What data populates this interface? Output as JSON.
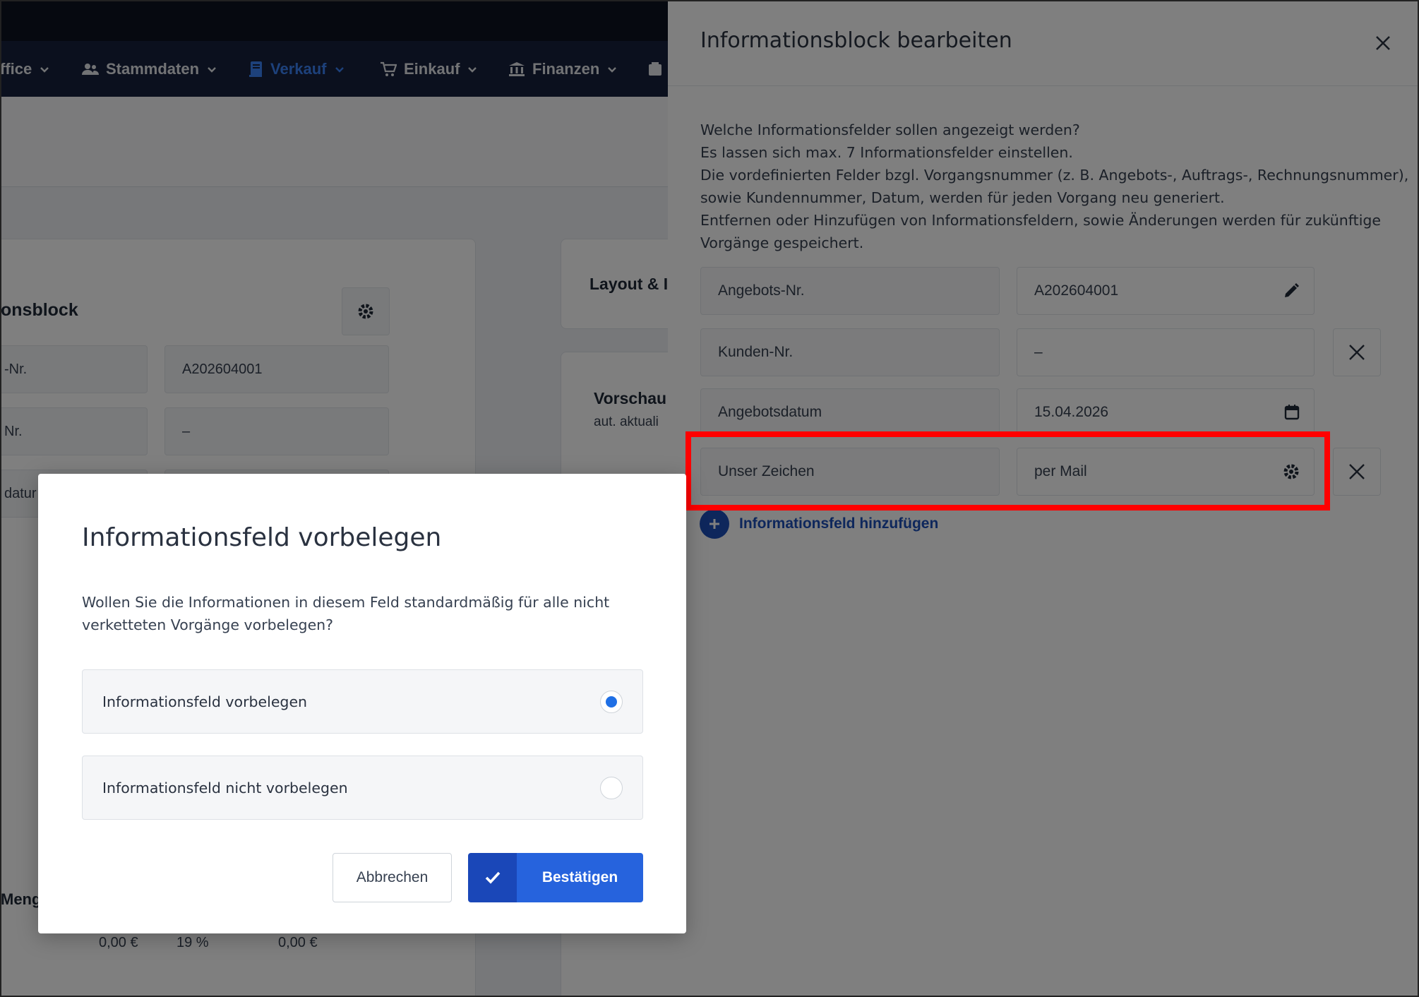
{
  "nav": {
    "items": [
      {
        "label": "ffice",
        "icon": "chevron-down-icon"
      },
      {
        "label": "Stammdaten",
        "icon": "users-icon"
      },
      {
        "label": "Verkauf",
        "icon": "document-icon",
        "active": true
      },
      {
        "label": "Einkauf",
        "icon": "cart-icon"
      },
      {
        "label": "Finanzen",
        "icon": "bank-icon"
      }
    ]
  },
  "background": {
    "block_title": "onsblock",
    "fields": [
      {
        "label": "-Nr.",
        "value": "A202604001"
      },
      {
        "label": "Nr.",
        "value": "–"
      },
      {
        "label": "datur",
        "value": ""
      }
    ],
    "layout_title": "Layout & I",
    "preview_title": "Vorschau",
    "preview_sub": "aut. aktuali",
    "table_header_fragment": "Menge",
    "table_values": [
      "0,00 €",
      "19 %",
      "0,00 €"
    ]
  },
  "panel": {
    "title": "Informationsblock bearbeiten",
    "description_lines": [
      "Welche Informationsfelder sollen angezeigt werden?",
      "Es lassen sich max. 7 Informationsfelder einstellen.",
      "Die vordefinierten Felder bzgl. Vorgangsnummer (z. B. Angebots-, Auftrags-, Rechnungsnummer),",
      "sowie Kundennummer, Datum, werden für jeden Vorgang neu generiert.",
      "Entfernen oder Hinzufügen von Informationsfeldern, sowie Änderungen werden für zukünftige",
      "Vorgänge gespeichert."
    ],
    "rows": [
      {
        "label": "Angebots-Nr.",
        "value": "A202604001",
        "value_icon": "pencil-icon",
        "removable": false
      },
      {
        "label": "Kunden-Nr.",
        "value": "–",
        "value_icon": "",
        "removable": true
      },
      {
        "label": "Angebotsdatum",
        "value": "15.04.2026",
        "value_icon": "calendar-icon",
        "removable": false
      },
      {
        "label": "Unser Zeichen",
        "value": "per Mail",
        "value_icon": "gear-icon",
        "removable": true
      }
    ],
    "add_field_label": "Informationsfeld hinzufügen"
  },
  "modal": {
    "title": "Informationsfeld vorbelegen",
    "text_lines": [
      "Wollen Sie die Informationen in diesem Feld standardmäßig für alle nicht",
      "verketteten Vorgänge vorbelegen?"
    ],
    "options": [
      {
        "label": "Informationsfeld vorbelegen",
        "selected": true
      },
      {
        "label": "Informationsfeld nicht vorbelegen",
        "selected": false
      }
    ],
    "cancel_label": "Abbrechen",
    "confirm_label": "Bestätigen"
  },
  "colors": {
    "accent": "#2663dd",
    "accent_dark": "#1a47b8",
    "highlight": "#ff0000",
    "nav_bg": "#17213d"
  }
}
